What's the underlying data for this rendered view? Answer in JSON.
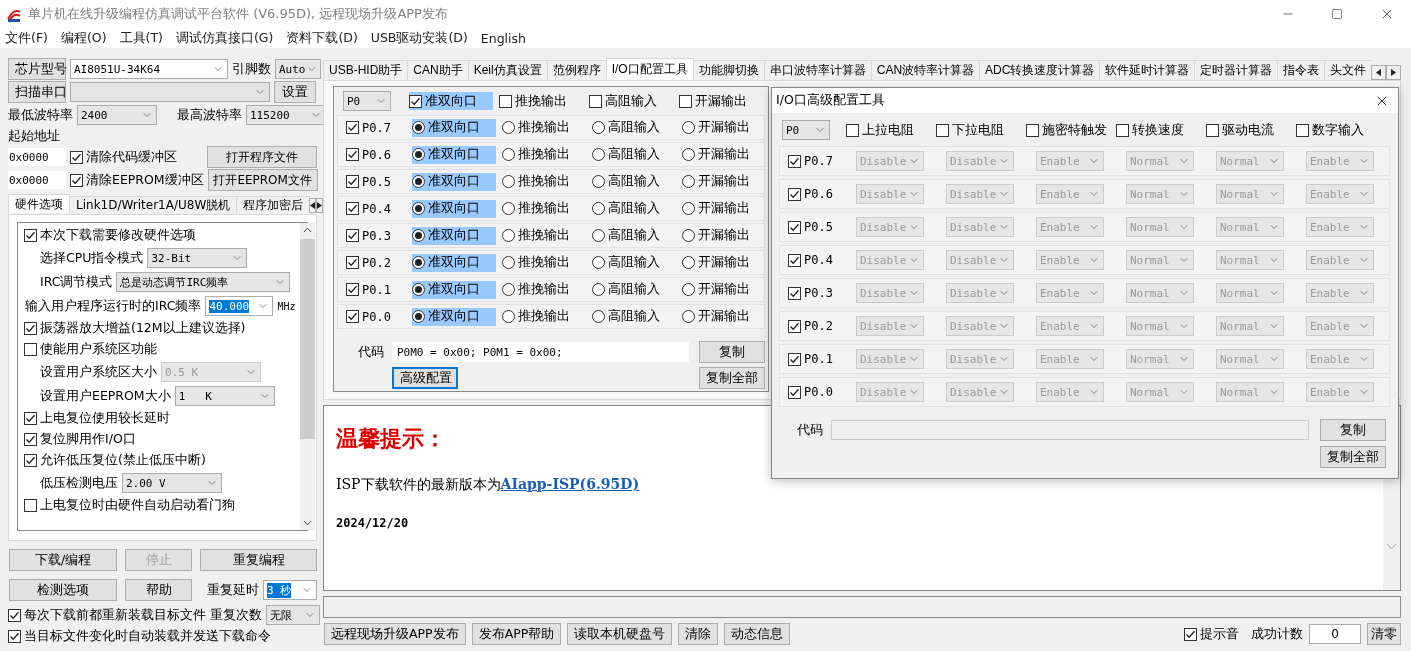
{
  "window": {
    "title": "单片机在线升级编程仿真调试平台软件 (V6.95D), 远程现场升级APP发布"
  },
  "menu": [
    "文件(F)",
    "编程(O)",
    "工具(T)",
    "调试仿真接口(G)",
    "资料下载(D)",
    "USB驱动安装(D)",
    "English"
  ],
  "left": {
    "chip": {
      "button": "芯片型号",
      "value": "AI8051U-34K64",
      "pins_label": "引脚数",
      "pins": "Auto"
    },
    "port": {
      "button": "扫描串口",
      "settings": "设置"
    },
    "baud": {
      "min_label": "最低波特率",
      "min": "2400",
      "max_label": "最高波特率",
      "max": "115200"
    },
    "start_label": "起始地址",
    "files": [
      {
        "address": "0x0000",
        "label": "清除代码缓冲区",
        "checked": true,
        "button": "打开程序文件"
      },
      {
        "address": "0x0000",
        "label": "清除EEPROM缓冲区",
        "checked": true,
        "button": "打开EEPROM文件"
      }
    ],
    "tabs": [
      {
        "label": "硬件选项",
        "selected": true
      },
      {
        "label": "Link1D/Writer1A/U8W脱机",
        "selected": false
      },
      {
        "label": "程序加密后",
        "selected": false
      }
    ],
    "options": [
      {
        "kind": "check",
        "label": "本次下载需要修改硬件选项",
        "checked": true
      },
      {
        "kind": "select",
        "label": "选择CPU指令模式",
        "value": "32-Bit",
        "disabled": false
      },
      {
        "kind": "wide_select",
        "label": "IRC调节模式",
        "value": "总是动态调节IRC频率",
        "disabled": false
      },
      {
        "kind": "input",
        "label": "输入用户程序运行时的IRC频率",
        "value": "40.000",
        "unit": "MHz",
        "text_selected": true
      },
      {
        "kind": "check",
        "label": "振荡器放大增益(12M以上建议选择)",
        "checked": true
      },
      {
        "kind": "check",
        "label": "使能用户系统区功能",
        "checked": false
      },
      {
        "kind": "select",
        "label": "设置用户系统区大小",
        "value": "0.5 K",
        "disabled": true
      },
      {
        "kind": "select",
        "label": "设置用户EEPROM大小",
        "value": "1   K",
        "disabled": false
      },
      {
        "kind": "check",
        "label": "上电复位使用较长延时",
        "checked": true
      },
      {
        "kind": "check",
        "label": "复位脚用作I/O口",
        "checked": true
      },
      {
        "kind": "check",
        "label": "允许低压复位(禁止低压中断)",
        "checked": true
      },
      {
        "kind": "select",
        "label": "低压检测电压",
        "value": "2.00 V",
        "disabled": false
      },
      {
        "kind": "check",
        "label": "上电复位时由硬件自动启动看门狗",
        "checked": false
      }
    ],
    "actions": [
      {
        "label": "下载/编程",
        "disabled": false
      },
      {
        "label": "停止",
        "disabled": true
      },
      {
        "label": "重复编程",
        "disabled": false
      },
      {
        "label": "检测选项",
        "disabled": false
      },
      {
        "label": "帮助",
        "disabled": false
      }
    ],
    "repeat_delay": {
      "label": "重复延时",
      "value": "3 秒",
      "text_selected": true
    },
    "repeat_count": {
      "label": "重复次数",
      "value": "无限"
    },
    "reload": [
      {
        "label": "每次下载前都重新装载目标文件",
        "checked": true
      },
      {
        "label": "当目标文件变化时自动装载并发送下载命令",
        "checked": true
      }
    ]
  },
  "tabs": [
    {
      "label": "USB-HID助手",
      "selected": false
    },
    {
      "label": "CAN助手",
      "selected": false
    },
    {
      "label": "Keil仿真设置",
      "selected": false
    },
    {
      "label": "范例程序",
      "selected": false
    },
    {
      "label": "I/O口配置工具",
      "selected": true
    },
    {
      "label": "功能脚切换",
      "selected": false
    },
    {
      "label": "串口波特率计算器",
      "selected": false
    },
    {
      "label": "CAN波特率计算器",
      "selected": false
    },
    {
      "label": "ADC转换速度计算器",
      "selected": false
    },
    {
      "label": "软件延时计算器",
      "selected": false
    },
    {
      "label": "定时器计算器",
      "selected": false
    },
    {
      "label": "指令表",
      "selected": false
    },
    {
      "label": "头文件",
      "selected": false
    }
  ],
  "io": {
    "port": "P0",
    "header": [
      {
        "label": "准双向口",
        "checked": true
      },
      {
        "label": "推挽输出",
        "checked": false
      },
      {
        "label": "高阻输入",
        "checked": false
      },
      {
        "label": "开漏输出",
        "checked": false
      }
    ],
    "rows": [
      {
        "pin": "P0.7",
        "checked": true,
        "modes": [
          {
            "label": "准双向口",
            "selected": true
          },
          {
            "label": "推挽输出",
            "selected": false
          },
          {
            "label": "高阻输入",
            "selected": false
          },
          {
            "label": "开漏输出",
            "selected": false
          }
        ]
      },
      {
        "pin": "P0.6",
        "checked": true,
        "modes": [
          {
            "label": "准双向口",
            "selected": true
          },
          {
            "label": "推挽输出",
            "selected": false
          },
          {
            "label": "高阻输入",
            "selected": false
          },
          {
            "label": "开漏输出",
            "selected": false
          }
        ]
      },
      {
        "pin": "P0.5",
        "checked": true,
        "modes": [
          {
            "label": "准双向口",
            "selected": true
          },
          {
            "label": "推挽输出",
            "selected": false
          },
          {
            "label": "高阻输入",
            "selected": false
          },
          {
            "label": "开漏输出",
            "selected": false
          }
        ]
      },
      {
        "pin": "P0.4",
        "checked": true,
        "modes": [
          {
            "label": "准双向口",
            "selected": true
          },
          {
            "label": "推挽输出",
            "selected": false
          },
          {
            "label": "高阻输入",
            "selected": false
          },
          {
            "label": "开漏输出",
            "selected": false
          }
        ]
      },
      {
        "pin": "P0.3",
        "checked": true,
        "modes": [
          {
            "label": "准双向口",
            "selected": true
          },
          {
            "label": "推挽输出",
            "selected": false
          },
          {
            "label": "高阻输入",
            "selected": false
          },
          {
            "label": "开漏输出",
            "selected": false
          }
        ]
      },
      {
        "pin": "P0.2",
        "checked": true,
        "modes": [
          {
            "label": "准双向口",
            "selected": true
          },
          {
            "label": "推挽输出",
            "selected": false
          },
          {
            "label": "高阻输入",
            "selected": false
          },
          {
            "label": "开漏输出",
            "selected": false
          }
        ]
      },
      {
        "pin": "P0.1",
        "checked": true,
        "modes": [
          {
            "label": "准双向口",
            "selected": true
          },
          {
            "label": "推挽输出",
            "selected": false
          },
          {
            "label": "高阻输入",
            "selected": false
          },
          {
            "label": "开漏输出",
            "selected": false
          }
        ]
      },
      {
        "pin": "P0.0",
        "checked": true,
        "modes": [
          {
            "label": "准双向口",
            "selected": true
          },
          {
            "label": "推挽输出",
            "selected": false
          },
          {
            "label": "高阻输入",
            "selected": false
          },
          {
            "label": "开漏输出",
            "selected": false
          }
        ]
      }
    ],
    "code_label": "代码",
    "code": "P0M0 = 0x00; P0M1 = 0x00;",
    "copy": "复制",
    "advanced": {
      "label": "高级配置",
      "focused": true
    },
    "copy_all": "复制全部"
  },
  "notice": {
    "title": "温馨提示：",
    "text": "ISP下载软件的最新版本为",
    "link": "AIapp-ISP(6.95D)",
    "date": "2024/12/20"
  },
  "footer": {
    "buttons": [
      "远程现场升级APP发布",
      "发布APP帮助",
      "读取本机硬盘号",
      "清除",
      "动态信息"
    ],
    "sound": {
      "label": "提示音",
      "checked": true
    },
    "count_label": "成功计数",
    "count": "0",
    "reset": "清零"
  },
  "dialog": {
    "title": "I/O口高级配置工具",
    "port": "P0",
    "fields_disabled": true,
    "header": [
      {
        "label": "上拉电阻",
        "checked": false
      },
      {
        "label": "下拉电阻",
        "checked": false
      },
      {
        "label": "施密特触发",
        "checked": false
      },
      {
        "label": "转换速度",
        "checked": false
      },
      {
        "label": "驱动电流",
        "checked": false
      },
      {
        "label": "数字输入",
        "checked": false
      }
    ],
    "rows": [
      {
        "pin": "P0.7",
        "checked": true,
        "values": [
          "Disable",
          "Disable",
          "Enable",
          "Normal",
          "Normal",
          "Enable"
        ]
      },
      {
        "pin": "P0.6",
        "checked": true,
        "values": [
          "Disable",
          "Disable",
          "Enable",
          "Normal",
          "Normal",
          "Enable"
        ]
      },
      {
        "pin": "P0.5",
        "checked": true,
        "values": [
          "Disable",
          "Disable",
          "Enable",
          "Normal",
          "Normal",
          "Enable"
        ]
      },
      {
        "pin": "P0.4",
        "checked": true,
        "values": [
          "Disable",
          "Disable",
          "Enable",
          "Normal",
          "Normal",
          "Enable"
        ]
      },
      {
        "pin": "P0.3",
        "checked": true,
        "values": [
          "Disable",
          "Disable",
          "Enable",
          "Normal",
          "Normal",
          "Enable"
        ]
      },
      {
        "pin": "P0.2",
        "checked": true,
        "values": [
          "Disable",
          "Disable",
          "Enable",
          "Normal",
          "Normal",
          "Enable"
        ]
      },
      {
        "pin": "P0.1",
        "checked": true,
        "values": [
          "Disable",
          "Disable",
          "Enable",
          "Normal",
          "Normal",
          "Enable"
        ]
      },
      {
        "pin": "P0.0",
        "checked": true,
        "values": [
          "Disable",
          "Disable",
          "Enable",
          "Normal",
          "Normal",
          "Enable"
        ]
      }
    ],
    "code_label": "代码",
    "copy": "复制",
    "copy_all": "复制全部"
  }
}
